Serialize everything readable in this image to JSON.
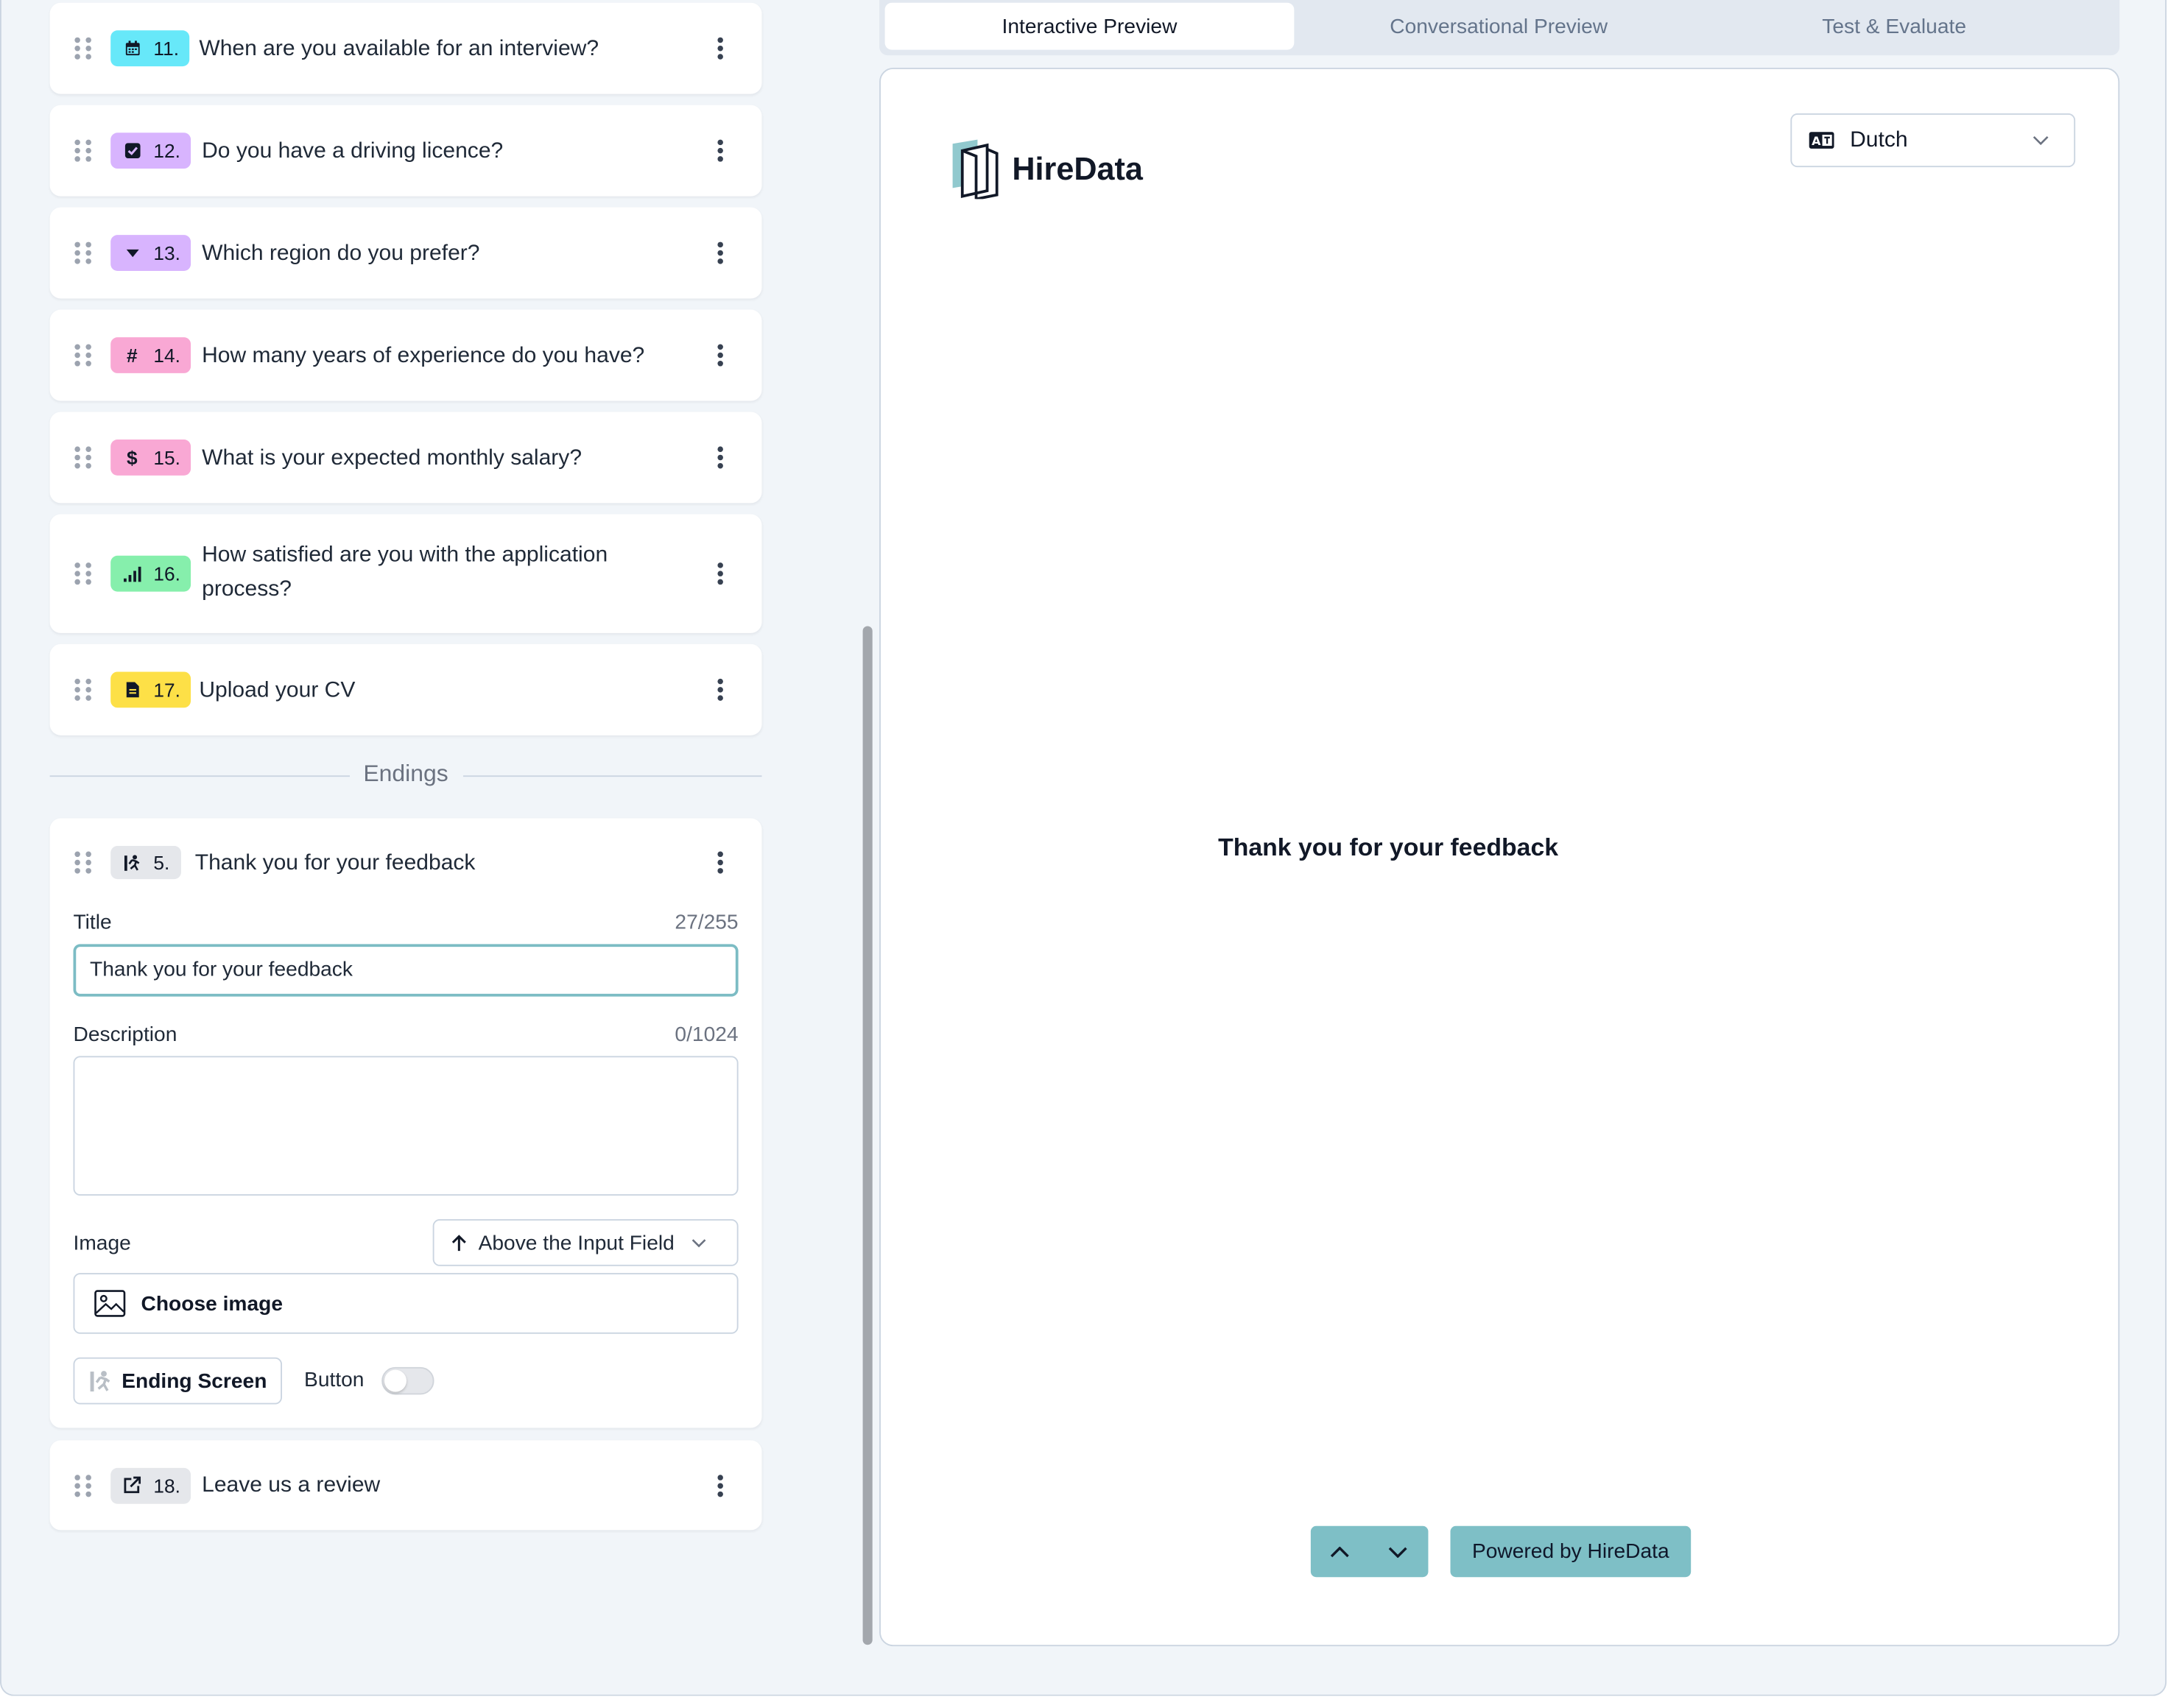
{
  "questions": [
    {
      "number": "11.",
      "title": "When are you available for an interview?",
      "icon": "calendar-icon",
      "color": "#67e8f9"
    },
    {
      "number": "12.",
      "title": "Do you have a driving licence?",
      "icon": "checkbox-icon",
      "color": "#d8b4fe"
    },
    {
      "number": "13.",
      "title": "Which region do you prefer?",
      "icon": "dropdown-icon",
      "color": "#d8b4fe"
    },
    {
      "number": "14.",
      "title": "How many years of experience do you have?",
      "icon": "hash-icon",
      "color": "#f9a8d4"
    },
    {
      "number": "15.",
      "title": "What is your expected monthly salary?",
      "icon": "dollar-icon",
      "color": "#f9a8d4"
    },
    {
      "number": "16.",
      "title_line1": "How satisfied are you with the application",
      "title_line2": "process?",
      "icon": "rating-bars-icon",
      "color": "#86efac"
    },
    {
      "number": "17.",
      "title": "Upload your CV",
      "icon": "file-icon",
      "color": "#fde047"
    }
  ],
  "endings_label": "Endings",
  "ending_card": {
    "number": "5.",
    "title": "Thank you for your feedback",
    "icon": "runner-icon",
    "badge_color": "#e5e7eb",
    "title_label": "Title",
    "title_count": "27/255",
    "title_value": "Thank you for your feedback",
    "description_label": "Description",
    "description_count": "0/1024",
    "description_value": "",
    "image_label": "Image",
    "image_position": "Above the Input Field",
    "choose_image": "Choose image",
    "ending_screen_button": "Ending Screen",
    "button_toggle_label": "Button",
    "button_toggle_on": false
  },
  "review_card": {
    "number": "18.",
    "title": "Leave us a review",
    "icon": "external-link-icon",
    "color": "#e5e7eb"
  },
  "tabs": [
    "Interactive Preview",
    "Conversational Preview",
    "Test & Evaluate"
  ],
  "active_tab": "Interactive Preview",
  "preview": {
    "brand": "HireData",
    "language": "Dutch",
    "ending_title": "Thank you for your feedback",
    "powered_by": "Powered by HireData"
  },
  "colors": {
    "accent": "#7ebfc6",
    "input_focus": "#7cbcc4",
    "background": "#f1f5f9"
  }
}
